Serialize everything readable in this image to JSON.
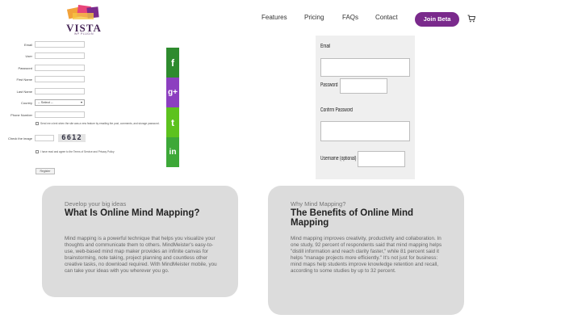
{
  "header": {
    "logo_text": "VISTA",
    "logo_sub": "WP PLUGIN",
    "nav": [
      "Features",
      "Pricing",
      "FAQs",
      "Contact"
    ],
    "join_label": "Join Beta"
  },
  "reg_form": {
    "labels": [
      "Email",
      "User",
      "Password",
      "First Name",
      "Last Name",
      "Country",
      "Phone Number"
    ],
    "select_value": "-- Select --",
    "sms_notice": "Send me a text when the site was a new feature by emailing the post, comments, and storage password.",
    "captcha_label": "Check the image",
    "captcha_code": "6612",
    "terms_text": "I have read and agree to the Terms of Service and Privacy Policy",
    "register_label": "Register"
  },
  "social": [
    "f",
    "g+",
    "t",
    "in"
  ],
  "side_form": {
    "email_label": "Email",
    "password_label": "Password",
    "confirm_label": "Confirm Password",
    "username_label": "Username (optional)"
  },
  "cards": [
    {
      "eyebrow": "Develop your big ideas",
      "title": "What Is Online Mind Mapping?",
      "body": "Mind mapping is a powerful technique that helps you visualize your thoughts and communicate them to others. MindMeister's easy-to-use, web-based mind map maker provides an infinite canvas for brainstorming, note taking, project planning and countless other creative tasks, no download required. With MindMeister mobile, you can take your ideas with you wherever you go."
    },
    {
      "eyebrow": "Why Mind Mapping?",
      "title": "The Benefits of Online Mind Mapping",
      "body": "Mind mapping improves creativity, productivity and collaboration. In one study, 92 percent of respondents said that mind mapping helps \"distill information and reach clarity faster,\" while 81 percent said it helps \"manage projects more efficiently.\" It's not just for business: mind maps help students improve knowledge retention and recall, according to some studies by up to 32 percent."
    }
  ]
}
